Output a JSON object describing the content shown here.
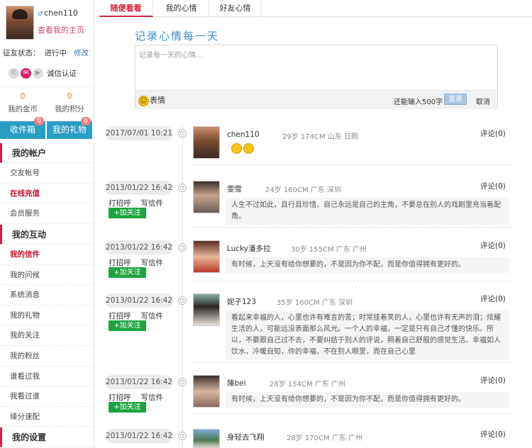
{
  "profile": {
    "username": "chen110",
    "home_link": "查看我的主页",
    "status_label": "征友状态：",
    "status_value": "进行中",
    "status_edit": "修改",
    "cert_label": "诚信认证"
  },
  "stats": {
    "coins_value": "0",
    "coins_label": "我的金币",
    "points_value": "0",
    "points_label": "我的积分"
  },
  "mail": {
    "inbox_label": "收件箱",
    "inbox_badge": "0",
    "gifts_label": "我的礼物",
    "gifts_badge": "0"
  },
  "nav": {
    "account_head": "我的帐户",
    "account_items": [
      "交友帐号",
      "在线充值",
      "会员服务"
    ],
    "interact_head": "我的互动",
    "interact_items": [
      "我的信件",
      "我的问候",
      "系统消息",
      "我的礼物",
      "我的关注",
      "我的粉丝",
      "谁看过我",
      "我看过谁",
      "缘分速配"
    ],
    "settings_head": "我的设置"
  },
  "tabs": [
    "随便看看",
    "我的心情",
    "好友心情"
  ],
  "mood": {
    "title": "记录心情每一天",
    "placeholder": "记录每一天的心情...",
    "emoji_label": "表情",
    "remaining": "还能输入500字",
    "send": "发表",
    "cancel": "取消"
  },
  "posts": [
    {
      "date": "2017/07/01 10:21",
      "name": "chen110",
      "age": "29岁",
      "height": "174CM",
      "location": "山东 日照",
      "comment": "评论(0)",
      "text": "",
      "emoji_count": 2,
      "show_actions": false
    },
    {
      "date": "2013/01/22 16:42",
      "name": "雯雪",
      "age": "24岁",
      "height": "160CM",
      "location": "广东 深圳",
      "comment": "评论(0)",
      "text": "人生不过如此，且行且珍惜，自己永远是自己的主角，不要总在别人的戏剧里充当着配角。",
      "show_actions": true
    },
    {
      "date": "2013/01/22 16:42",
      "name": "Lucky潘多拉",
      "age": "30岁",
      "height": "155CM",
      "location": "广东 广州",
      "comment": "评论(0)",
      "text": "有时候，上天没有给你想要的，不是因为你不配，而是你值得拥有更好的。",
      "show_actions": true
    },
    {
      "date": "2013/01/22 16:42",
      "name": "妮子123",
      "age": "35岁",
      "height": "160CM",
      "location": "广东 深圳",
      "comment": "评论(0)",
      "text": "看起来幸福的人，心里也许有难言的苦；时常挂着笑的人，心里也许有无声的泪；炫耀生活的人，可能远没表面那么风光。一个人的幸福，一定是只有自己才懂的快乐。所以，不要跟自己过不去，不要纠结于别人的评说，照着自己舒服的感觉生活。幸福如人饮水，冷暖自知，你的幸福，不在别人眼里，而在自己心里",
      "show_actions": true
    },
    {
      "date": "2013/01/22 16:42",
      "name": "陳bei",
      "age": "28岁",
      "height": "154CM",
      "location": "广东 广州",
      "comment": "评论(0)",
      "text": "有时候，上天没有给你想要的，不是因为你不配，而是你值得拥有更好的。",
      "show_actions": true
    },
    {
      "date": "2013/01/22 16:42",
      "name": "身轻去飞翔",
      "age": "28岁",
      "height": "170CM",
      "location": "广东 广州",
      "comment": "评论(0)",
      "text": "",
      "show_actions": false
    }
  ],
  "actions": {
    "greet": "打招呼",
    "write": "写信件",
    "follow": "+加关注"
  },
  "colors": {
    "accent_red": "#d0243e",
    "mail_blue": "#2a9fc4",
    "follow_green": "#1ca43e",
    "title_blue": "#3b8fd0"
  }
}
